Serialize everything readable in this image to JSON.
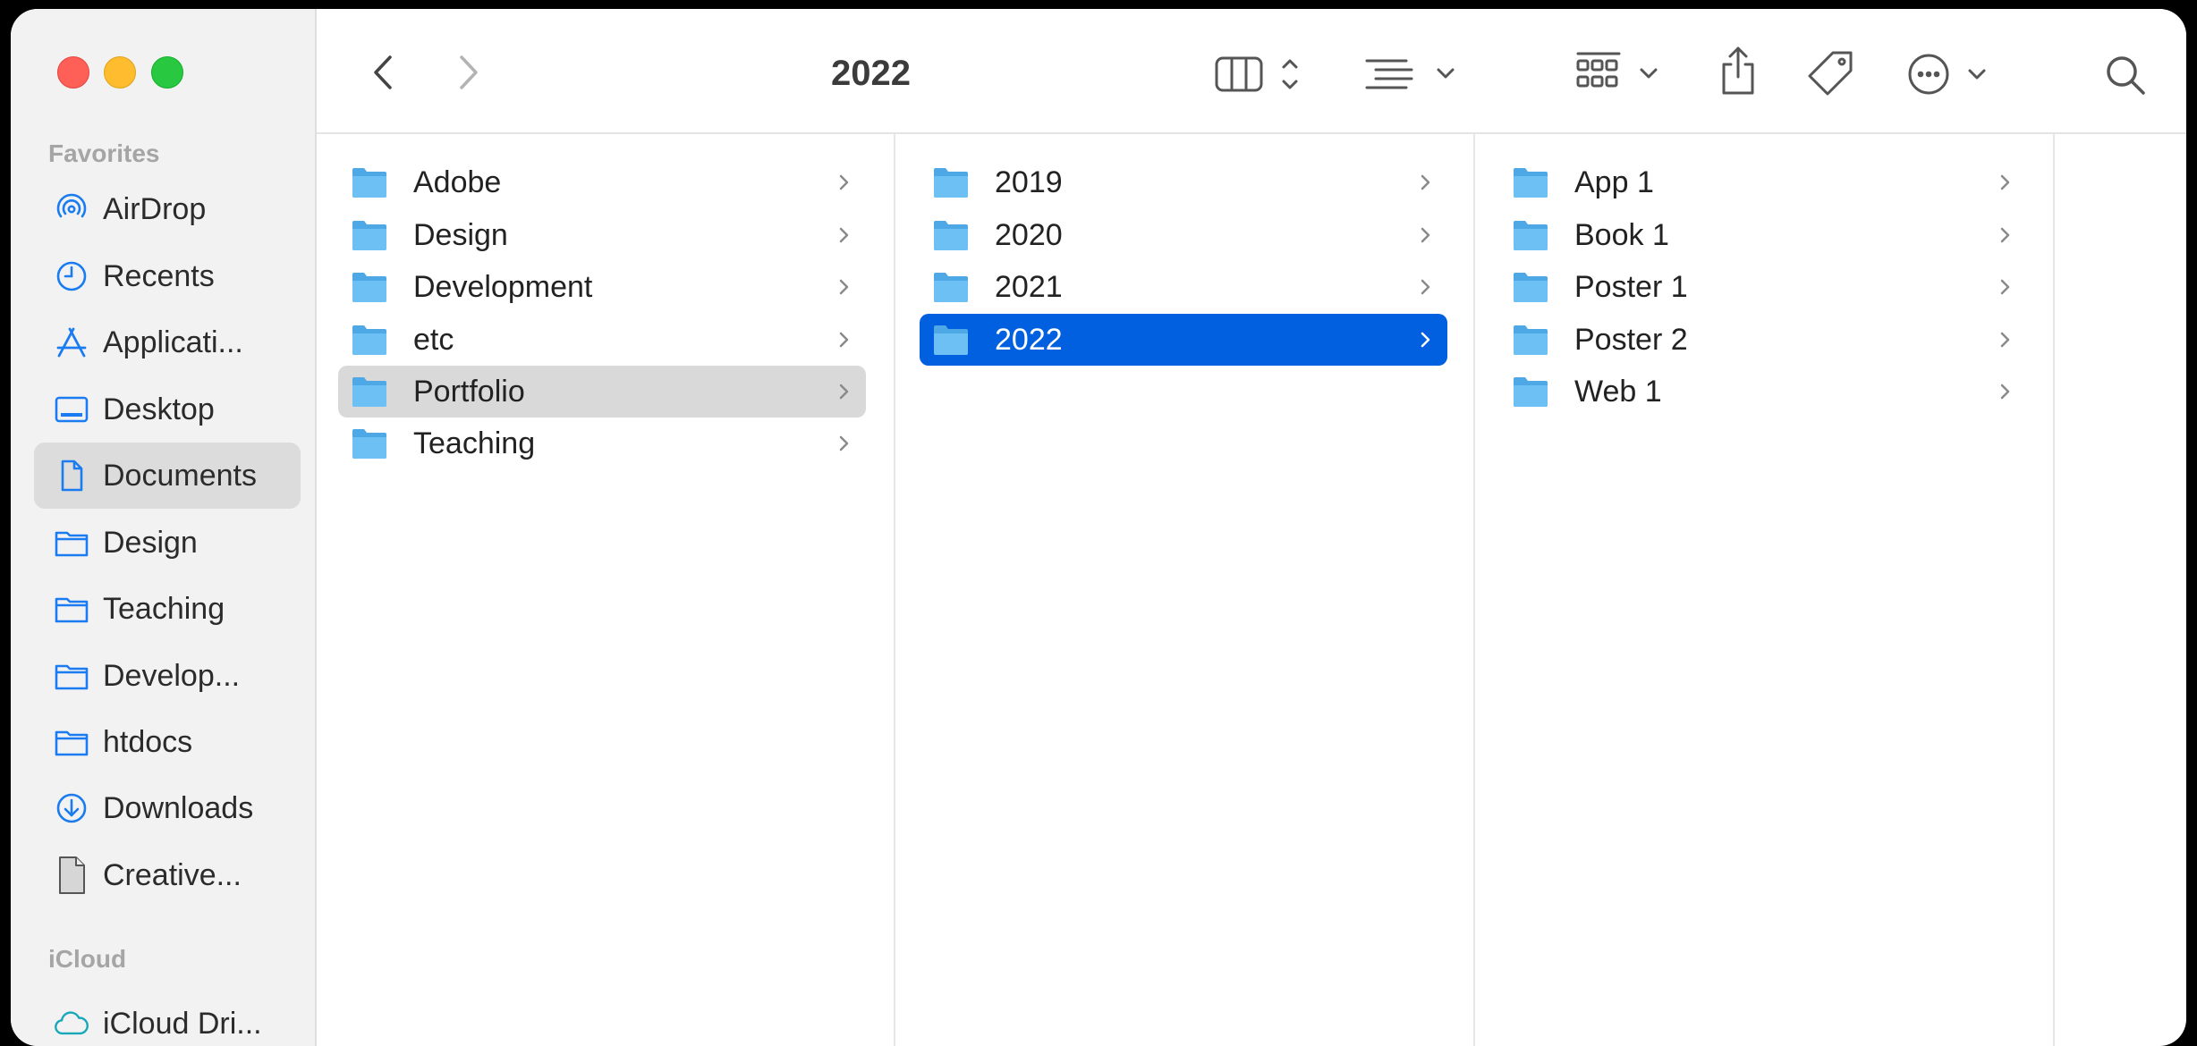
{
  "window": {
    "title": "2022"
  },
  "sidebar": {
    "sections": [
      {
        "label": "Favorites"
      },
      {
        "label": "iCloud"
      }
    ],
    "favorites": [
      {
        "label": "AirDrop",
        "icon": "airdrop-icon"
      },
      {
        "label": "Recents",
        "icon": "clock-icon"
      },
      {
        "label": "Applicati...",
        "icon": "applications-icon"
      },
      {
        "label": "Desktop",
        "icon": "desktop-icon"
      },
      {
        "label": "Documents",
        "icon": "document-icon"
      },
      {
        "label": "Design",
        "icon": "folder-icon"
      },
      {
        "label": "Teaching",
        "icon": "folder-icon"
      },
      {
        "label": "Develop...",
        "icon": "folder-icon"
      },
      {
        "label": "htdocs",
        "icon": "folder-icon"
      },
      {
        "label": "Downloads",
        "icon": "download-icon"
      },
      {
        "label": "Creative...",
        "icon": "file-icon"
      }
    ],
    "icloud": [
      {
        "label": "iCloud Dri...",
        "icon": "cloud-icon"
      }
    ],
    "selected_favorite": "Documents"
  },
  "toolbar": {
    "back": "back-icon",
    "forward": "forward-icon",
    "view_mode": "columns-view-icon",
    "group": "list-group-icon",
    "gallery": "grid-icon",
    "share": "share-icon",
    "tag": "tag-icon",
    "more": "ellipsis-icon",
    "search": "search-icon"
  },
  "columns": [
    {
      "items": [
        "Adobe",
        "Design",
        "Development",
        "etc",
        "Portfolio",
        "Teaching"
      ],
      "active": "Portfolio"
    },
    {
      "items": [
        "2019",
        "2020",
        "2021",
        "2022"
      ],
      "selected": "2022"
    },
    {
      "items": [
        "App 1",
        "Book 1",
        "Poster 1",
        "Poster 2",
        "Web 1"
      ]
    }
  ],
  "colors": {
    "accent": "#0060df",
    "folder": "#5ab4ee",
    "sidebar_icon": "#1a7cf0",
    "icloud_icon": "#16a7b8"
  }
}
